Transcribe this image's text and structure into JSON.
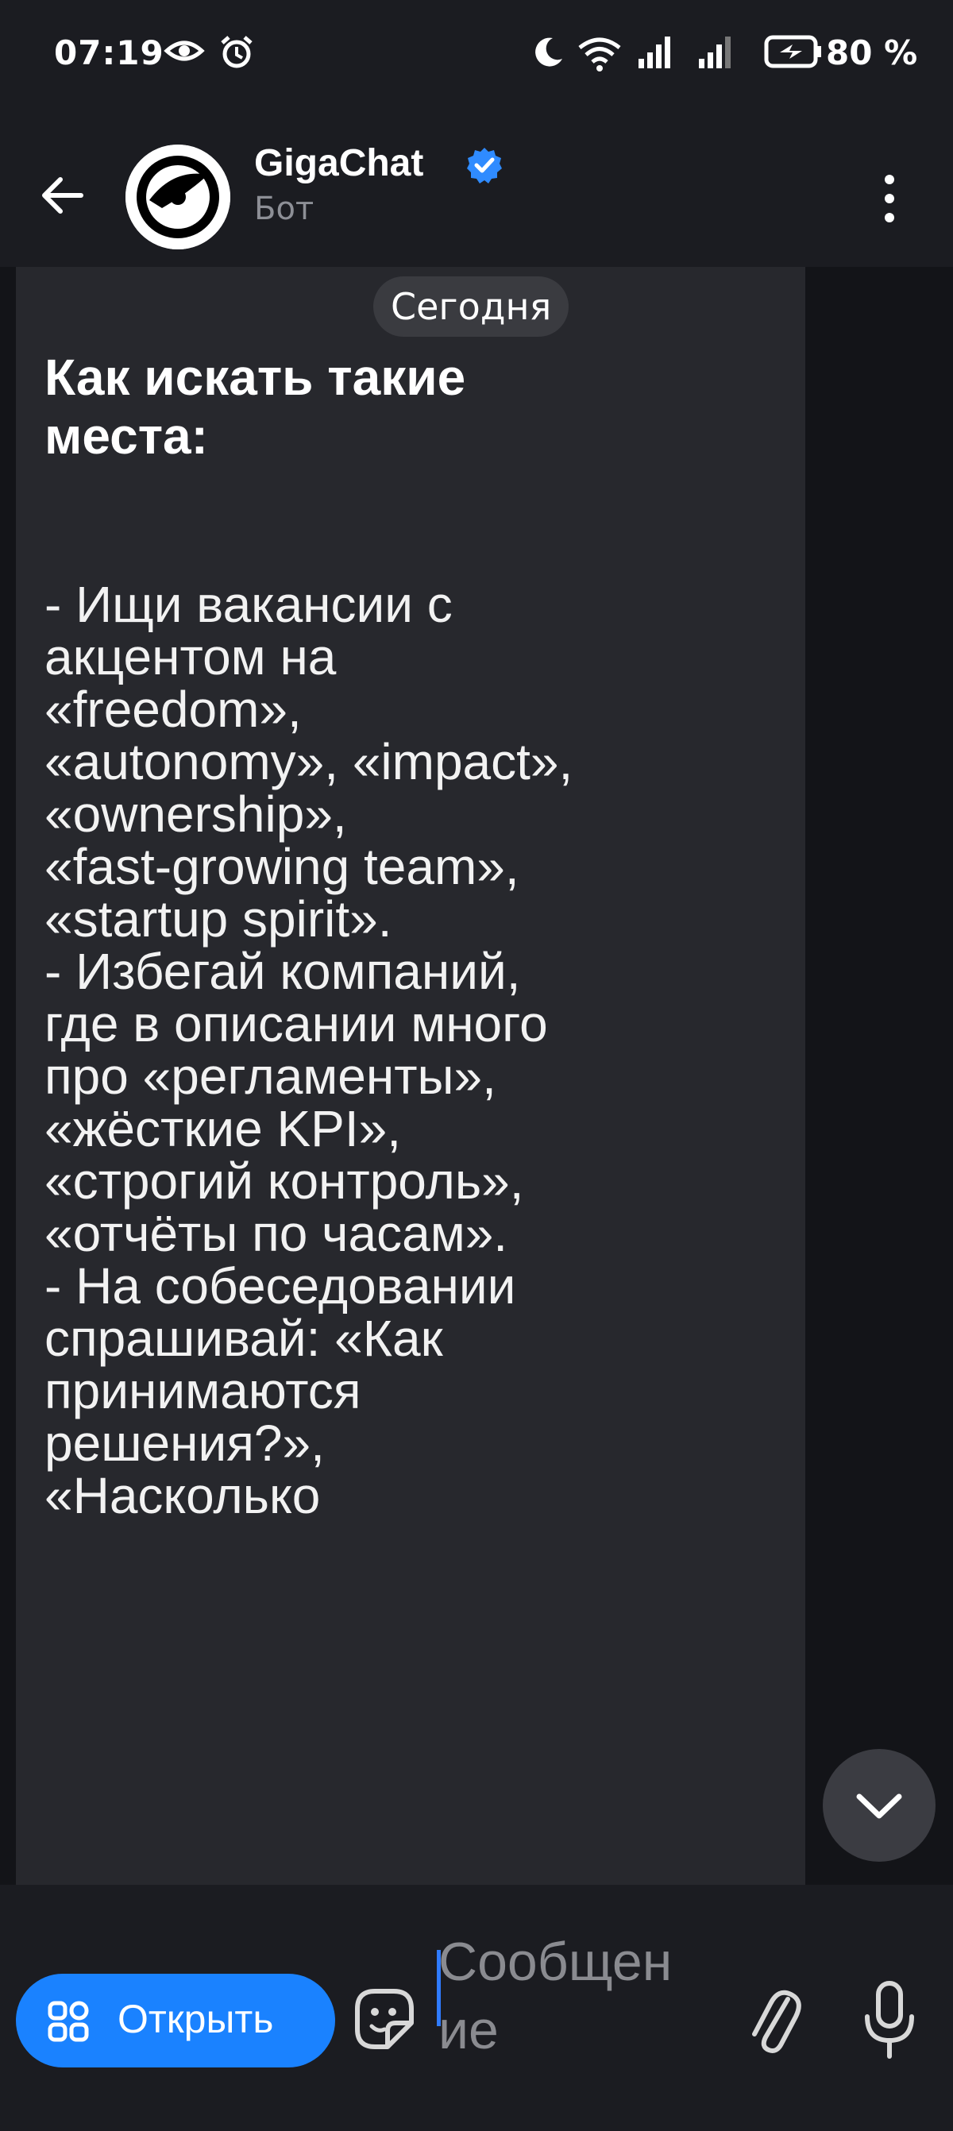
{
  "status_bar": {
    "time": "07:19",
    "battery": "80 %",
    "icons": [
      "eye-icon",
      "alarm-icon",
      "moon-icon",
      "wifi-icon",
      "signal-icon",
      "signal-icon",
      "battery-icon"
    ]
  },
  "header": {
    "title": "GigaChat",
    "subtitle": "Бот",
    "icons": {
      "back": "arrow-left-icon",
      "verified": "verified-check-icon",
      "menu": "more-vertical-icon"
    }
  },
  "chat": {
    "date_label": "Сегодня",
    "message": {
      "title": "Как искать такие\nместа:",
      "body": "- Ищи вакансии с\nакцентом на\n«freedom»,\n«autonomy», «impact»,\n«ownership»,\n«fast-growing team»,\n«startup spirit».\n- Избегай компаний,\nгде в описании много\nпро «регламенты»,\n«жёсткие KPI»,\n«строгий контроль»,\n«отчёты по часам».\n- На собеседовании\nспрашивай: «Как\nпринимаются\nрешения?»,\n«Насколько"
    }
  },
  "input_bar": {
    "open_label": "Открыть",
    "placeholder": "Сообщение",
    "icons": {
      "open": "mini-app-grid-icon",
      "sticker": "sticker-icon",
      "attach": "paperclip-icon",
      "mic": "microphone-icon"
    }
  },
  "colors": {
    "background": "#131418",
    "bar": "#1b1c21",
    "bubble": "#27282d",
    "accent": "#1a82ff"
  }
}
